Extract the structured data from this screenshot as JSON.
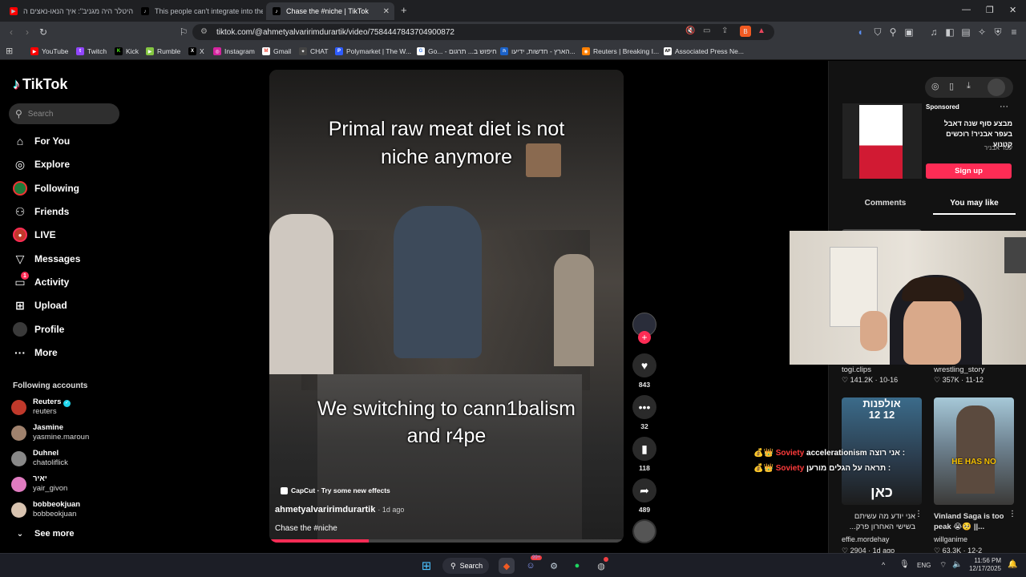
{
  "browser": {
    "tabs": [
      {
        "title": "\"היטלר היה מגניב\": איך הנאו-נאצים ה",
        "favicon": "youtube-icon",
        "active": false
      },
      {
        "title": "This people can't integrate into the w",
        "favicon": "tiktok-icon",
        "active": false
      },
      {
        "title": "Chase the #niche | TikTok",
        "favicon": "tiktok-icon",
        "active": true
      }
    ],
    "new_tab": "+",
    "url": "tiktok.com/@ahmetyalvaririmdurartik/video/7584447843704900872",
    "bookmarks": [
      {
        "label": "YouTube",
        "color": "#ff0000",
        "glyph": "▶"
      },
      {
        "label": "Twitch",
        "color": "#9146ff",
        "glyph": "t"
      },
      {
        "label": "Kick",
        "color": "#53fc18",
        "glyph": "K"
      },
      {
        "label": "Rumble",
        "color": "#85c742",
        "glyph": "▶"
      },
      {
        "label": "X",
        "color": "#000000",
        "glyph": "X"
      },
      {
        "label": "Instagram",
        "color": "#d6249f",
        "glyph": "◎"
      },
      {
        "label": "Gmail",
        "color": "#ea4335",
        "glyph": "M"
      },
      {
        "label": "CHAT",
        "color": "#444444",
        "glyph": "✦"
      },
      {
        "label": "Polymarket | The W...",
        "color": "#2e5cff",
        "glyph": "P"
      },
      {
        "label": "Go... - חיפוש ב... תרגום",
        "color": "#4285f4",
        "glyph": "G"
      },
      {
        "label": "הארץ - חדשות, ידיעו...",
        "color": "#1b62c9",
        "glyph": "ה"
      },
      {
        "label": "Reuters | Breaking I...",
        "color": "#ff8000",
        "glyph": "◉"
      },
      {
        "label": "Associated Press Ne...",
        "color": "#ffffff",
        "glyph": "AP"
      }
    ]
  },
  "sidebar": {
    "logo": "TikTok",
    "search_placeholder": "Search",
    "nav": [
      {
        "label": "For You",
        "icon": "home-icon"
      },
      {
        "label": "Explore",
        "icon": "compass-icon"
      },
      {
        "label": "Following",
        "icon": "following-icon"
      },
      {
        "label": "Friends",
        "icon": "friends-icon"
      },
      {
        "label": "LIVE",
        "icon": "live-icon"
      },
      {
        "label": "Messages",
        "icon": "messages-icon"
      },
      {
        "label": "Activity",
        "icon": "activity-icon",
        "badge": "1"
      },
      {
        "label": "Upload",
        "icon": "upload-icon"
      },
      {
        "label": "Profile",
        "icon": "profile-icon"
      },
      {
        "label": "More",
        "icon": "more-icon"
      }
    ],
    "following_heading": "Following accounts",
    "accounts": [
      {
        "name": "Reuters",
        "handle": "reuters",
        "verified": true,
        "color": "#c0392b"
      },
      {
        "name": "Jasmine",
        "handle": "yasmine.maroun",
        "verified": false,
        "color": "#a0826d"
      },
      {
        "name": "Duhnel",
        "handle": "chatoliflick",
        "verified": false,
        "color": "#888888"
      },
      {
        "name": "יאיר",
        "handle": "yair_givon",
        "verified": false,
        "color": "#e07bc0"
      },
      {
        "name": "bobbeokjuan",
        "handle": "bobbeokjuan",
        "verified": false,
        "color": "#d8c3b0"
      }
    ],
    "see_more": "See more"
  },
  "video": {
    "caption_top_1": "Primal raw meat diet is not",
    "caption_top_2": "niche anymore",
    "caption_bottom_1": "We switching to cann1balism",
    "caption_bottom_2": "and r4pe",
    "capcut": "CapCut · Try some new effects",
    "author": "ahmetyalvaririmdurartik",
    "time": "· 1d ago",
    "description": "Chase the #niche",
    "progress": 0.28
  },
  "actions": {
    "follow": "+",
    "likes": "843",
    "comments": "32",
    "saves": "118",
    "shares": "489"
  },
  "right": {
    "sponsored": "Sponsored",
    "ad_text": "מבצע סוף שנה דאבל בעפר אבניר! רוכשים קטנוע",
    "ad_brand": "עפר אבניר",
    "signup": "Sign up",
    "tab_comments": "Comments",
    "tab_youmaylike": "You may like",
    "grid": [
      {
        "author": "togi.clips",
        "stats": "♡ 141.2K · 10-16"
      },
      {
        "author": "wrestling_story",
        "stats": "♡ 357K · 11-12"
      },
      {
        "title": "אני יודע מה עשיתם בשישי האחרון פרק...",
        "author": "effie.mordehay",
        "stats": "♡ 2904 · 1d ago",
        "overlay_1": "אולפנות",
        "overlay_2": "12 12",
        "overlay_3": "כאן"
      },
      {
        "title": "Vinland Saga is too peak 😭🥺 ||...",
        "author": "willganime",
        "stats": "♡ 63.3K · 12-2",
        "overlay_1": "HE HAS NO"
      }
    ]
  },
  "chat": [
    {
      "user": "Soviety",
      "text": "acceleration‏ism אני רוצה :"
    },
    {
      "user": "Soviety",
      "text": "תראה על הגלים מורען :"
    }
  ],
  "taskbar": {
    "search": "Search",
    "lang": "ENG",
    "time": "11:56 PM",
    "date": "12/17/2025",
    "discord_badge": "99+"
  }
}
